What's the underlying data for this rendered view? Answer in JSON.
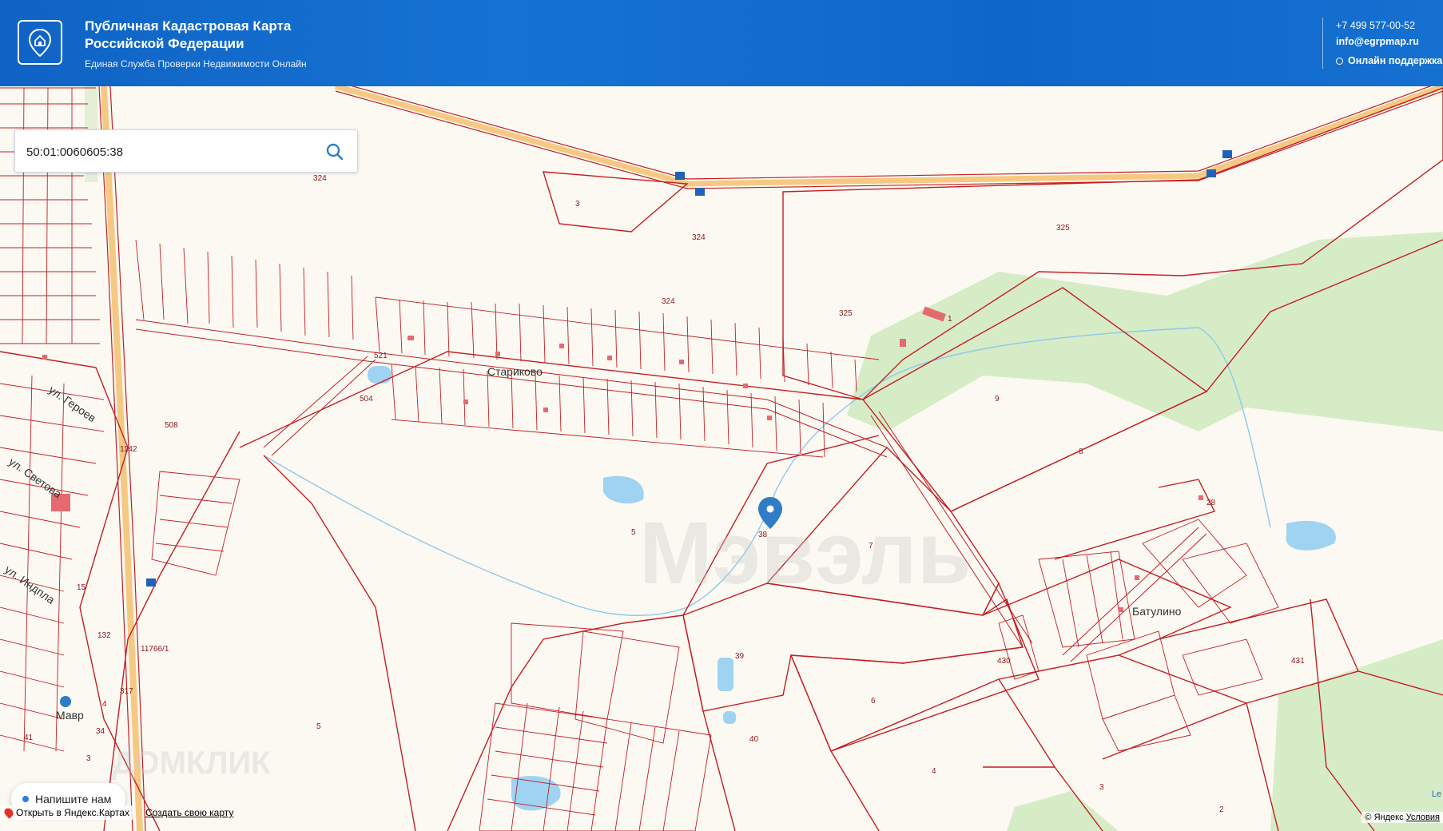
{
  "header": {
    "title_line1": "Публичная Кадастровая Карта",
    "title_line2": "Российской Федерации",
    "subtitle": "Единая Служба Проверки Недвижимости Онлайн",
    "phone": "+7 499 577-00-52",
    "email": "info@egrpmap.ru",
    "support": "Онлайн поддержка"
  },
  "search": {
    "value": "50:01:0060605:38"
  },
  "map": {
    "places": [
      "Стариково",
      "Батулино",
      "Мавр"
    ],
    "streets": [
      "ул. Героев",
      "ул. Светова",
      "ул. Индпла"
    ],
    "watermarks": [
      "Мэвэль",
      "ДОМКЛИК"
    ],
    "marker_label": "38",
    "parcels": [
      "324",
      "325",
      "3",
      "324",
      "1",
      "9",
      "8",
      "7",
      "5",
      "6",
      "4",
      "3",
      "2",
      "39",
      "40",
      "431",
      "430",
      "15",
      "132",
      "508",
      "521",
      "504",
      "1142",
      "11766/1",
      "317",
      "34",
      "41",
      "5"
    ]
  },
  "chat": {
    "label": "Напишите нам"
  },
  "footer": {
    "open_yandex": "Открыть в Яндекс.Картах",
    "create_map": "Создать свою карту",
    "copyright": "© Яндекс",
    "terms": "Условия",
    "corner": "Le"
  },
  "colors": {
    "header_blue": "#1570d0",
    "parcel_red": "#c41e24",
    "forest_green": "#d6ecc6",
    "water": "#9fd3f2",
    "marker": "#2f7ec5"
  }
}
